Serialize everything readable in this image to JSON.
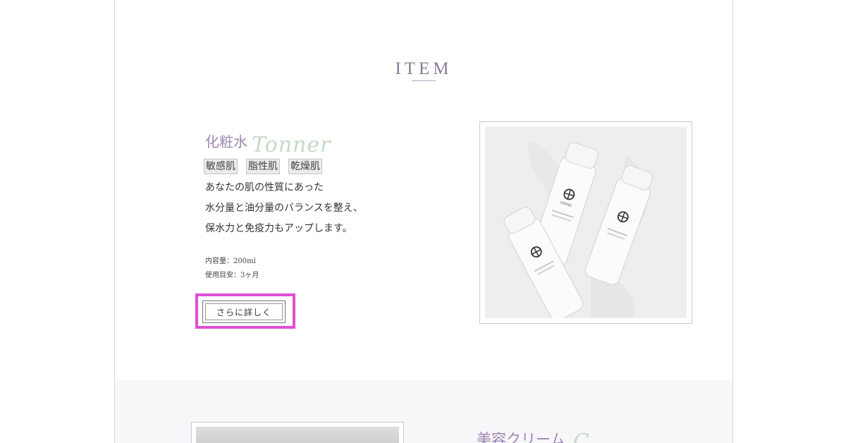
{
  "section": {
    "title": "ITEM"
  },
  "product": {
    "title": "化粧水",
    "script": "Tonner",
    "tags": [
      "敏感肌",
      "脂性肌",
      "乾燥肌"
    ],
    "description": [
      "あなたの肌の性質にあった",
      "水分量と油分量のバランスを整え、",
      "保水力と免疫力もアップします。"
    ],
    "specs": {
      "volume": "内容量：200ml",
      "usage": "使用目安：3ヶ月"
    },
    "cta_label": "さらに詳しく"
  },
  "product_image": {
    "brand": "OHME"
  },
  "next_product": {
    "title": "美容クリーム",
    "script": "C"
  },
  "colors": {
    "accent": "#9f86b4",
    "highlight": "#e04fd3",
    "script_green": "#c6d9c6"
  }
}
